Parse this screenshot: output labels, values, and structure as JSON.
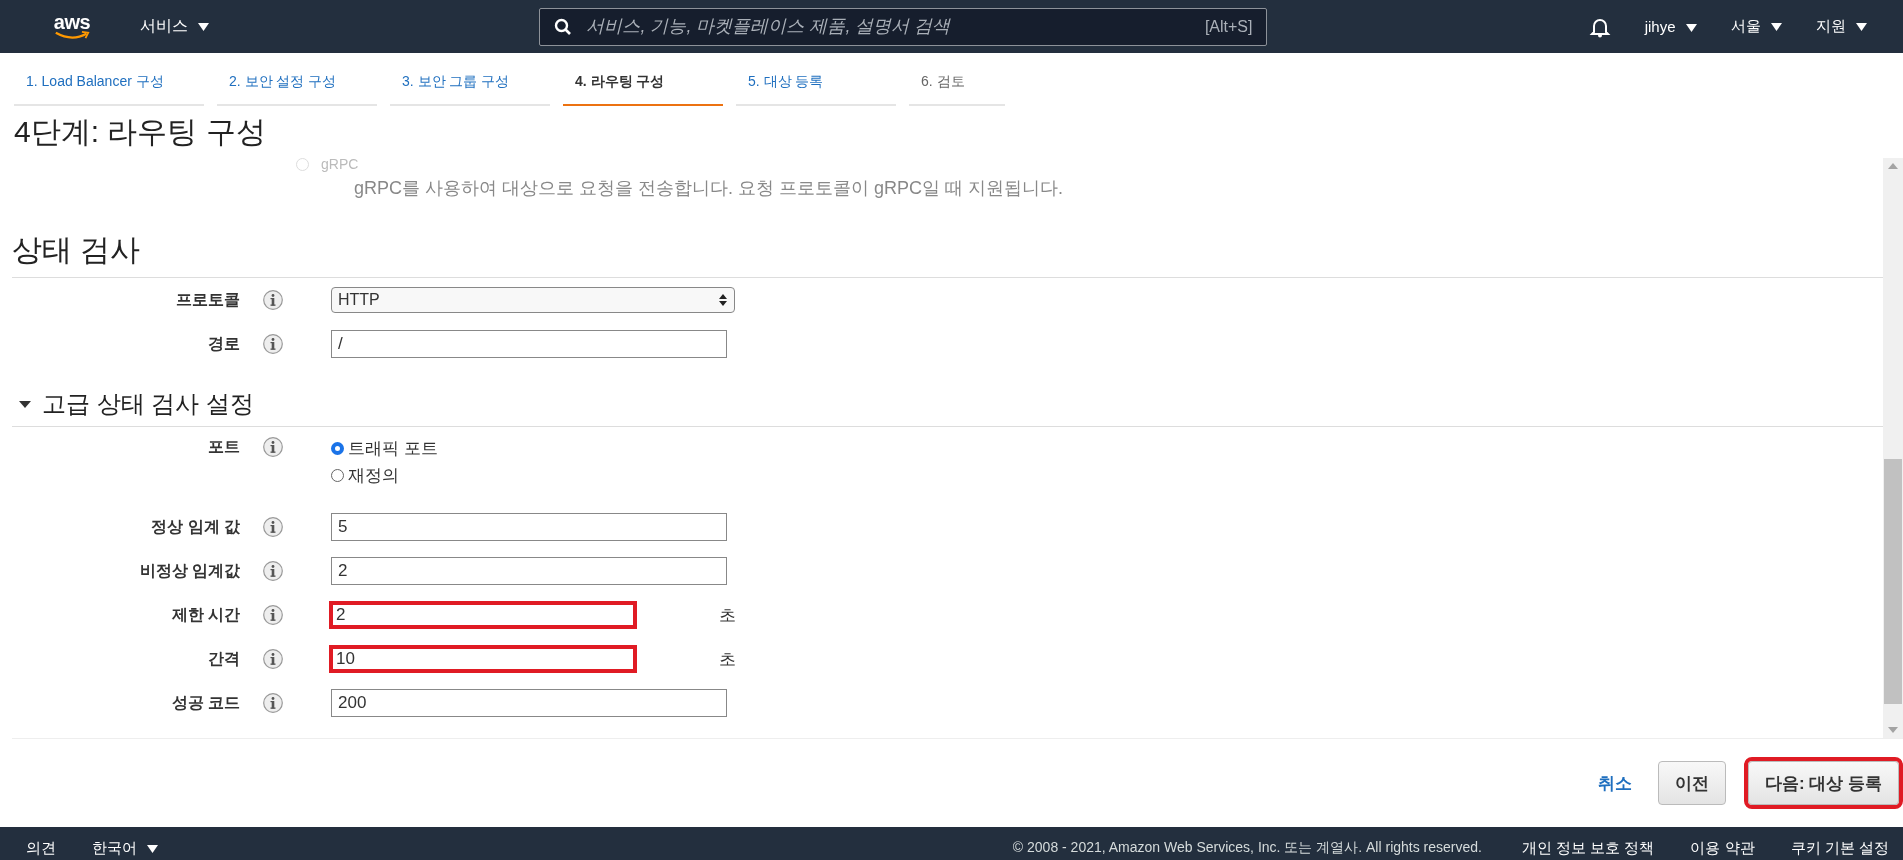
{
  "nav": {
    "logo": "aws",
    "services": "서비스",
    "search": {
      "placeholder": "서비스, 기능, 마켓플레이스 제품, 설명서 검색",
      "shortcut": "[Alt+S]"
    },
    "menus": [
      "jihye",
      "서울",
      "지원"
    ]
  },
  "steps": [
    {
      "label": "1. Load Balancer 구성",
      "selected": false
    },
    {
      "label": "2. 보안 설정 구성",
      "selected": false
    },
    {
      "label": "3. 보안 그룹 구성",
      "selected": false
    },
    {
      "label": "4. 라우팅 구성",
      "selected": true
    },
    {
      "label": "5. 대상 등록",
      "selected": false
    },
    {
      "label": "6. 검토",
      "selected": false
    }
  ],
  "page_title": "4단계: 라우팅 구성",
  "protocol_option": {
    "label": "gRPC",
    "selected": false,
    "description": "gRPC를 사용하여 대상으로 요청을 전송합니다. 요청 프로토콜이 gRPC일 때 지원됩니다."
  },
  "health_check": {
    "title": "상태 검사",
    "fields": [
      {
        "label": "프로토콜",
        "kind": "select",
        "value": "HTTP"
      },
      {
        "label": "경로",
        "kind": "text",
        "value": "/"
      }
    ]
  },
  "advanced": {
    "title": "고급 상태 검사 설정",
    "expanded": true,
    "port": {
      "label": "포트",
      "options": [
        {
          "label": "트래픽 포트",
          "selected": true
        },
        {
          "label": "재정의",
          "selected": false
        }
      ]
    },
    "fields": [
      {
        "label": "정상 임계 값",
        "value": "5",
        "highlighted": false
      },
      {
        "label": "비정상 임계값",
        "value": "2",
        "highlighted": false
      },
      {
        "label": "제한 시간",
        "value": "2",
        "unit": "초",
        "highlighted": true
      },
      {
        "label": "간격",
        "value": "10",
        "unit": "초",
        "highlighted": true
      },
      {
        "label": "성공 코드",
        "value": "200",
        "highlighted": false
      }
    ]
  },
  "actions": {
    "cancel": "취소",
    "previous": "이전",
    "next": {
      "label": "다음: 대상 등록",
      "highlighted": true
    }
  },
  "footer": {
    "feedback": "의견",
    "language": "한국어",
    "copyright": "© 2008 - 2021, Amazon Web Services, Inc. 또는 계열사. All rights reserved.",
    "links": [
      "개인 정보 보호 정책",
      "이용 약관",
      "쿠키 기본 설정"
    ]
  }
}
